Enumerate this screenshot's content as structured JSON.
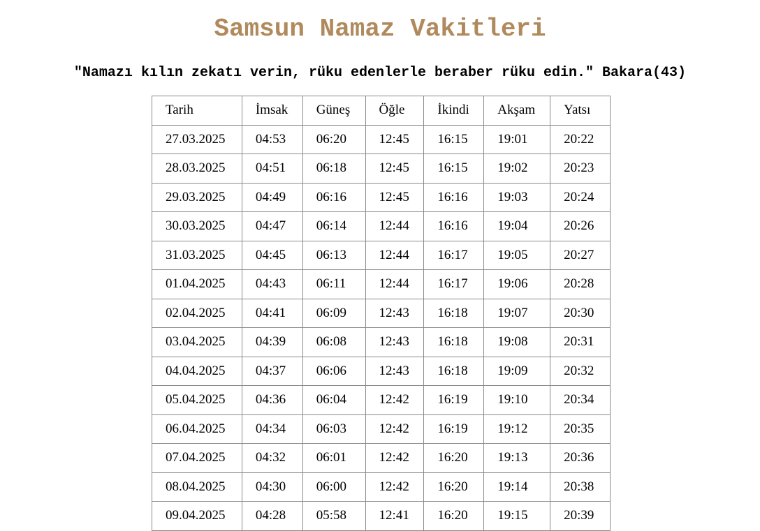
{
  "page": {
    "title": "Samsun Namaz Vakitleri",
    "verse": "\"Namazı kılın zekatı verin, rüku edenlerle beraber rüku edin.\" Bakara(43)"
  },
  "table": {
    "headers": [
      "Tarih",
      "İmsak",
      "Güneş",
      "Öğle",
      "İkindi",
      "Akşam",
      "Yatsı"
    ],
    "rows": [
      [
        "27.03.2025",
        "04:53",
        "06:20",
        "12:45",
        "16:15",
        "19:01",
        "20:22"
      ],
      [
        "28.03.2025",
        "04:51",
        "06:18",
        "12:45",
        "16:15",
        "19:02",
        "20:23"
      ],
      [
        "29.03.2025",
        "04:49",
        "06:16",
        "12:45",
        "16:16",
        "19:03",
        "20:24"
      ],
      [
        "30.03.2025",
        "04:47",
        "06:14",
        "12:44",
        "16:16",
        "19:04",
        "20:26"
      ],
      [
        "31.03.2025",
        "04:45",
        "06:13",
        "12:44",
        "16:17",
        "19:05",
        "20:27"
      ],
      [
        "01.04.2025",
        "04:43",
        "06:11",
        "12:44",
        "16:17",
        "19:06",
        "20:28"
      ],
      [
        "02.04.2025",
        "04:41",
        "06:09",
        "12:43",
        "16:18",
        "19:07",
        "20:30"
      ],
      [
        "03.04.2025",
        "04:39",
        "06:08",
        "12:43",
        "16:18",
        "19:08",
        "20:31"
      ],
      [
        "04.04.2025",
        "04:37",
        "06:06",
        "12:43",
        "16:18",
        "19:09",
        "20:32"
      ],
      [
        "05.04.2025",
        "04:36",
        "06:04",
        "12:42",
        "16:19",
        "19:10",
        "20:34"
      ],
      [
        "06.04.2025",
        "04:34",
        "06:03",
        "12:42",
        "16:19",
        "19:12",
        "20:35"
      ],
      [
        "07.04.2025",
        "04:32",
        "06:01",
        "12:42",
        "16:20",
        "19:13",
        "20:36"
      ],
      [
        "08.04.2025",
        "04:30",
        "06:00",
        "12:42",
        "16:20",
        "19:14",
        "20:38"
      ],
      [
        "09.04.2025",
        "04:28",
        "05:58",
        "12:41",
        "16:20",
        "19:15",
        "20:39"
      ]
    ]
  },
  "colors": {
    "title": "#b08a5c",
    "text": "#000000",
    "border": "#8a8a8a",
    "background": "#ffffff"
  }
}
